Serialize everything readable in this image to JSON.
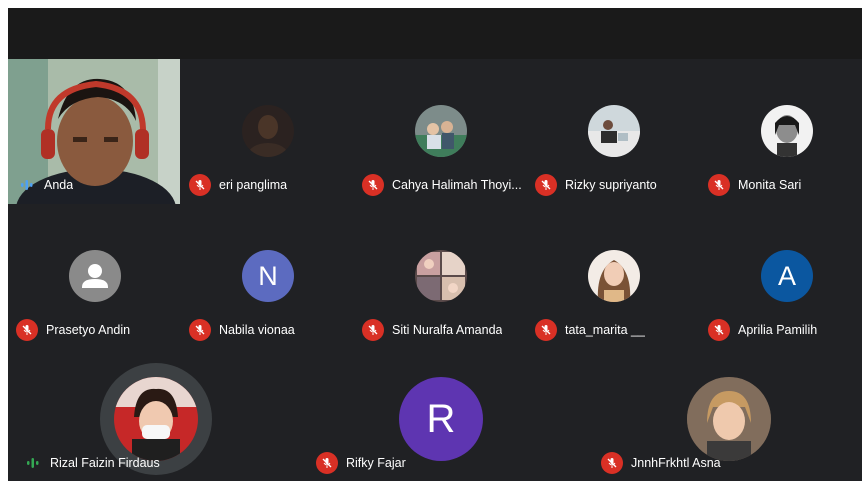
{
  "self": {
    "name": "Anda"
  },
  "participants": [
    {
      "name": "eri panglima",
      "muted": true,
      "avatar": "photo-dark"
    },
    {
      "name": "Cahya Halimah Thoyi...",
      "muted": true,
      "avatar": "photo-group"
    },
    {
      "name": "Rizky supriyanto",
      "muted": true,
      "avatar": "photo-outdoor"
    },
    {
      "name": "Monita Sari",
      "muted": true,
      "avatar": "photo-bw"
    },
    {
      "name": "Prasetyo Andin",
      "muted": true,
      "avatar": "default-person-icon"
    },
    {
      "name": "Nabila vionaa",
      "muted": true,
      "avatar": "letter",
      "letter": "N",
      "color": "#5c6bc0"
    },
    {
      "name": "Siti Nuralfa Amanda",
      "muted": true,
      "avatar": "photo-collage"
    },
    {
      "name": "tata_marita __",
      "muted": true,
      "avatar": "photo-portrait"
    },
    {
      "name": "Aprilia Pamilih",
      "muted": true,
      "avatar": "letter",
      "letter": "A",
      "color": "#0b57a0"
    },
    {
      "name": "Rizal Faizin Firdaus",
      "muted": false,
      "speaking": true,
      "avatar": "photo-mask"
    },
    {
      "name": "Rifky Fajar",
      "muted": true,
      "avatar": "letter",
      "letter": "R",
      "color": "#5e35b1"
    },
    {
      "name": "JnnhFrkhtl Asna",
      "muted": true,
      "avatar": "photo-warm"
    }
  ],
  "colors": {
    "background": "#202124",
    "mute": "#d93025",
    "speaking": "#1e8e3e"
  }
}
